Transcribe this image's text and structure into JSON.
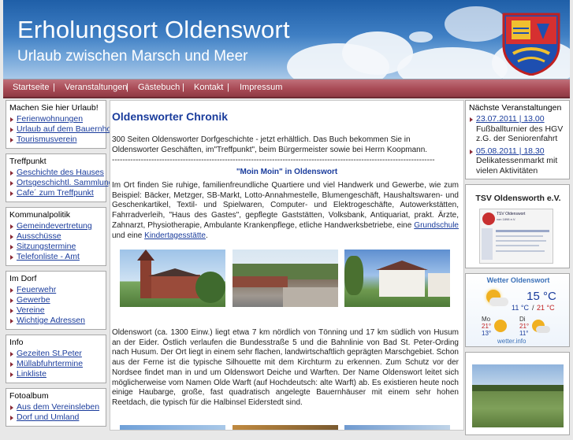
{
  "header": {
    "title": "Erholungsort Oldenswort",
    "subtitle": "Urlaub zwischen Marsch und Meer"
  },
  "nav": {
    "items": [
      "Startseite",
      "Veranstaltungen",
      "Gästebuch",
      "Kontakt",
      "Impressum"
    ],
    "separator": "|"
  },
  "sidebar": {
    "sections": [
      {
        "title": "Machen Sie hier Urlaub!",
        "items": [
          "Ferienwohnungen",
          "Urlaub auf dem Bauernhof",
          "Tourismusverein"
        ]
      },
      {
        "title": "Treffpunkt",
        "items": [
          "Geschichte des Hauses",
          "Ortsgeschichtl. Sammlung",
          "Cafe´ zum Treffpunkt"
        ]
      },
      {
        "title": "Kommunalpolitik",
        "items": [
          "Gemeindevertretung",
          "Ausschüsse",
          "Sitzungstermine",
          "Telefonliste - Amt"
        ]
      },
      {
        "title": "Im Dorf",
        "items": [
          "Feuerwehr",
          "Gewerbe",
          "Vereine",
          "Wichtige Adressen"
        ]
      },
      {
        "title": "Info",
        "items": [
          "Gezeiten St.Peter",
          "Müllabfuhrtermine",
          "Linkliste"
        ]
      },
      {
        "title": "Fotoalbum",
        "items": [
          "Aus dem Vereinsleben",
          "Dorf und Umland"
        ]
      }
    ]
  },
  "main": {
    "heading": "Oldensworter Chronik",
    "intro": "300 Seiten Oldensworter Dorfgeschichte - jetzt erhältlich. Das Buch bekommen Sie in Oldensworter Geschäften, im\"Treffpunkt\", beim Bürgermeister sowie bei Herrn Koopmann.",
    "divider": "---------------------------------------------------------------------------------------------------------------------------",
    "moin": "\"Moin Moin\" in Oldenswort",
    "para1": "Im Ort finden Sie ruhige, familienfreundliche Quartiere und viel Handwerk und Gewerbe, wie zum Beispiel: Bäcker, Metzger, SB-Markt, Lotto-Annahmestelle, Blumengeschäft, Haushaltswaren- und Geschenkartikel, Textil- und Spielwaren, Computer- und Elektrogeschäfte, Autowerkstätten, Fahrradverleih, \"Haus des Gastes\", gepflegte Gaststätten, Volksbank, Antiquariat, prakt. Ärzte, Zahnarzt, Physiotherapie, Ambulante Krankenpflege, etliche Handwerksbetriebe, eine",
    "para1_link1": "Grundschule",
    "para1_mid": " und eine ",
    "para1_link2": "Kindertagesstätte",
    "para1_end": ".",
    "para2": "Oldenswort (ca. 1300 Einw.) liegt etwa 7 km nördlich von Tönning und 17 km südlich von Husum an der Eider. Östlich verlaufen die Bundesstraße 5 und die Bahnlinie von Bad St. Peter-Ording nach Husum. Der Ort liegt in einem sehr flachen, landwirtschaftlich geprägten Marschgebiet. Schon aus der Ferne ist die typische Silhouette mit dem Kirchturm zu erkennen. Zum Schutz vor der Nordsee findet man in und um Oldenswort Deiche und Warften. Der Name Oldenswort leitet sich möglicherweise vom Namen Olde Warft (auf Hochdeutsch: alte Warft) ab. Es existieren heute noch einige Haubarge, große, fast quadratisch angelegte Bauernhäuser mit einem sehr hohen Reetdach, die typisch für die Halbinsel Eiderstedt sind."
  },
  "right": {
    "events_title": "Nächste Veranstaltungen",
    "events": [
      {
        "date": "23.07.2011 | 13.00",
        "text": "Fußballturnier des HGV z.G. der Seniorenfahrt"
      },
      {
        "date": "05.08.2011 | 18.30",
        "text": "Delikatessenmarkt mit vielen Aktivitäten"
      }
    ],
    "club_title": "TSV Oldensworth e.V.",
    "club_thumb_title": "TSV Oldenswort",
    "club_thumb_sub": "von 1898 e.V.",
    "weather": {
      "title": "Wetter Oldenswort",
      "temp": "15 °C",
      "range_low": "11 °C",
      "range_high": "21 °C",
      "day1": "Mo",
      "day1_hi": "21°",
      "day1_lo": "13°",
      "day2": "Di",
      "day2_hi": "21°",
      "day2_lo": "11°",
      "source": "wetter.info"
    }
  },
  "colors": {
    "link": "#1a3c9c",
    "nav": "#a84a55",
    "accent_red": "#8a2a36"
  }
}
